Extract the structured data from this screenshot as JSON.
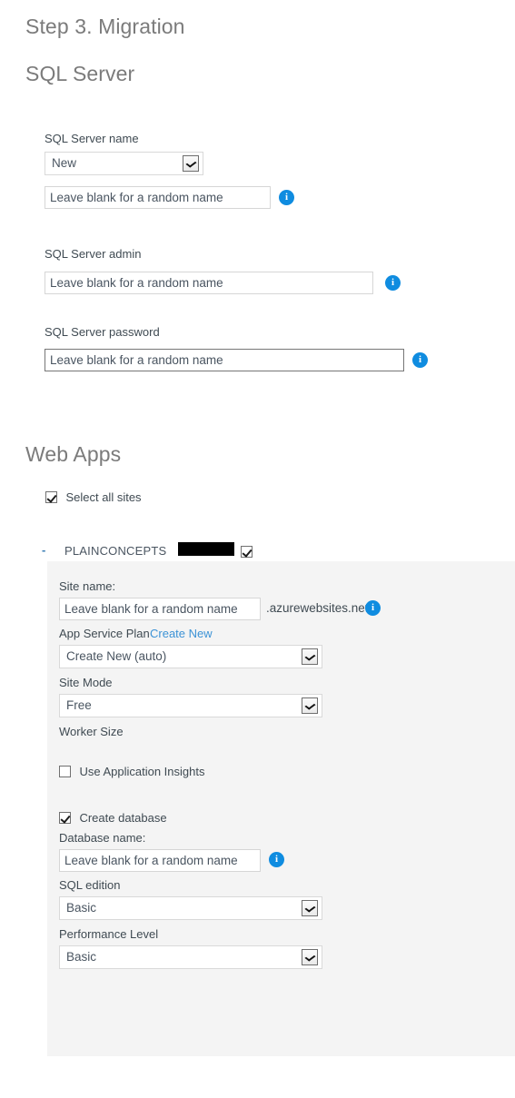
{
  "headings": {
    "step": "Step 3. Migration",
    "sql_server": "SQL Server",
    "web_apps": "Web Apps"
  },
  "sql_server": {
    "name_label": "SQL Server name",
    "name_select_value": "New",
    "name_input_value": "Leave blank for a random name",
    "name_info": "i",
    "admin_label": "SQL Server admin",
    "admin_input_value": "Leave blank for a random name",
    "admin_info": "i",
    "password_label": "SQL Server password",
    "password_input_value": "Leave blank for a random name",
    "password_info": "i"
  },
  "web_apps": {
    "select_all_label": "Select all sites",
    "site": {
      "toggle": "-",
      "title": "PLAINCONCEPTS",
      "site_name_label": "Site name:",
      "site_name_value": "Leave blank for a random name",
      "site_name_suffix": ".azurewebsites.net",
      "site_name_info": "i",
      "app_service_plan_label": "App Service Plan",
      "app_service_plan_link": "Create New",
      "app_service_plan_value": "Create New (auto)",
      "site_mode_label": "Site Mode",
      "site_mode_value": "Free",
      "worker_size_label": "Worker Size",
      "use_app_insights_label": "Use Application Insights",
      "create_database_label": "Create database",
      "database_name_label": "Database name:",
      "database_name_value": "Leave blank for a random name",
      "database_name_info": "i",
      "sql_edition_label": "SQL edition",
      "sql_edition_value": "Basic",
      "performance_level_label": "Performance Level",
      "performance_level_value": "Basic"
    }
  },
  "colors": {
    "heading": "#7b7b7b",
    "label": "#3f4a52",
    "link": "#3d93d6",
    "info_badge": "#0f8ce0",
    "panel_bg": "#f4f4f4"
  }
}
